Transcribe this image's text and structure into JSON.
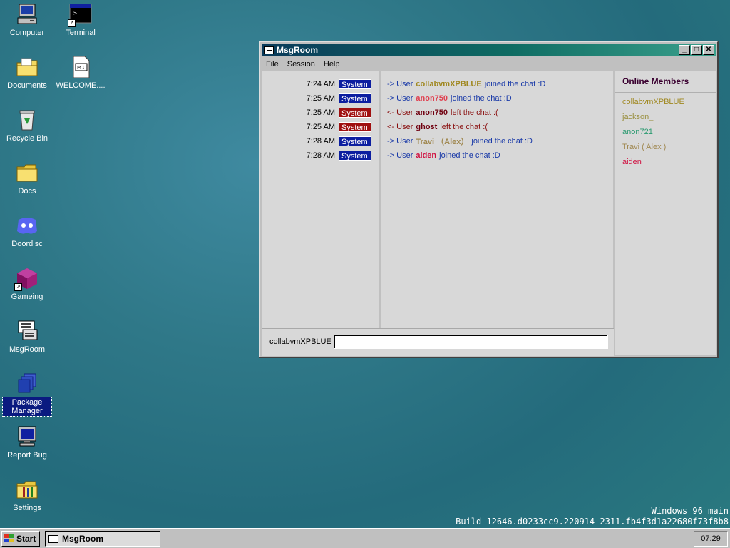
{
  "desktop": {
    "icons": [
      {
        "label": "Computer",
        "icon": "computer-icon"
      },
      {
        "label": "Terminal",
        "icon": "terminal-icon"
      },
      {
        "label": "Documents",
        "icon": "documents-folder-icon"
      },
      {
        "label": "WELCOME....",
        "icon": "markdown-file-icon"
      },
      {
        "label": "Recycle Bin",
        "icon": "recycle-bin-icon"
      },
      {
        "label": "Docs",
        "icon": "folder-icon"
      },
      {
        "label": "Doordisc",
        "icon": "doordisc-icon"
      },
      {
        "label": "Gameing",
        "icon": "cube-icon"
      },
      {
        "label": "MsgRoom",
        "icon": "msgroom-icon"
      },
      {
        "label": "Package Manager",
        "icon": "package-icon"
      },
      {
        "label": "Report Bug",
        "icon": "monitor-icon"
      },
      {
        "label": "Settings",
        "icon": "settings-icon"
      }
    ],
    "build_line1": "Windows 96 main",
    "build_line2": "Build 12646.d0233cc9.220914-2311.fb4f3d1a22680f73f8b8"
  },
  "window": {
    "title": "MsgRoom",
    "menu": [
      "File",
      "Session",
      "Help"
    ],
    "log": [
      {
        "time": "7:24 AM",
        "tag": "System",
        "kind": "join",
        "arrow": "->",
        "prefix": "User",
        "user": "collabvmXPBLUE",
        "user_color": "#a08820",
        "action": "joined the chat :D"
      },
      {
        "time": "7:25 AM",
        "tag": "System",
        "kind": "join",
        "arrow": "->",
        "prefix": "User",
        "user": "anon750",
        "user_color": "#e04050",
        "action": "joined the chat :D"
      },
      {
        "time": "7:25 AM",
        "tag": "System",
        "kind": "leave",
        "arrow": "<-",
        "prefix": "User",
        "user": "anon750",
        "user_color": "#700010",
        "action": "left the chat :("
      },
      {
        "time": "7:25 AM",
        "tag": "System",
        "kind": "leave",
        "arrow": "<-",
        "prefix": "User",
        "user": "ghost",
        "user_color": "#700010",
        "action": "left the chat :("
      },
      {
        "time": "7:28 AM",
        "tag": "System",
        "kind": "join",
        "arrow": "->",
        "prefix": "User",
        "user": "Travi （Alex）",
        "user_color": "#a08850",
        "action": "joined the chat :D"
      },
      {
        "time": "7:28 AM",
        "tag": "System",
        "kind": "join",
        "arrow": "->",
        "prefix": "User",
        "user": "aiden",
        "user_color": "#d01040",
        "action": "joined the chat :D"
      }
    ],
    "members_title": "Online Members",
    "members": [
      {
        "name": "collabvmXPBLUE",
        "color": "#a08820"
      },
      {
        "name": "jackson_",
        "color": "#9a9040"
      },
      {
        "name": "anon721",
        "color": "#2a9a70"
      },
      {
        "name": "Travi ( Alex )",
        "color": "#a08850"
      },
      {
        "name": "aiden",
        "color": "#d01040"
      }
    ],
    "nickname": "collabvmXPBLUE",
    "input_value": ""
  },
  "taskbar": {
    "start_label": "Start",
    "task_label": "MsgRoom",
    "clock": "07:29"
  }
}
